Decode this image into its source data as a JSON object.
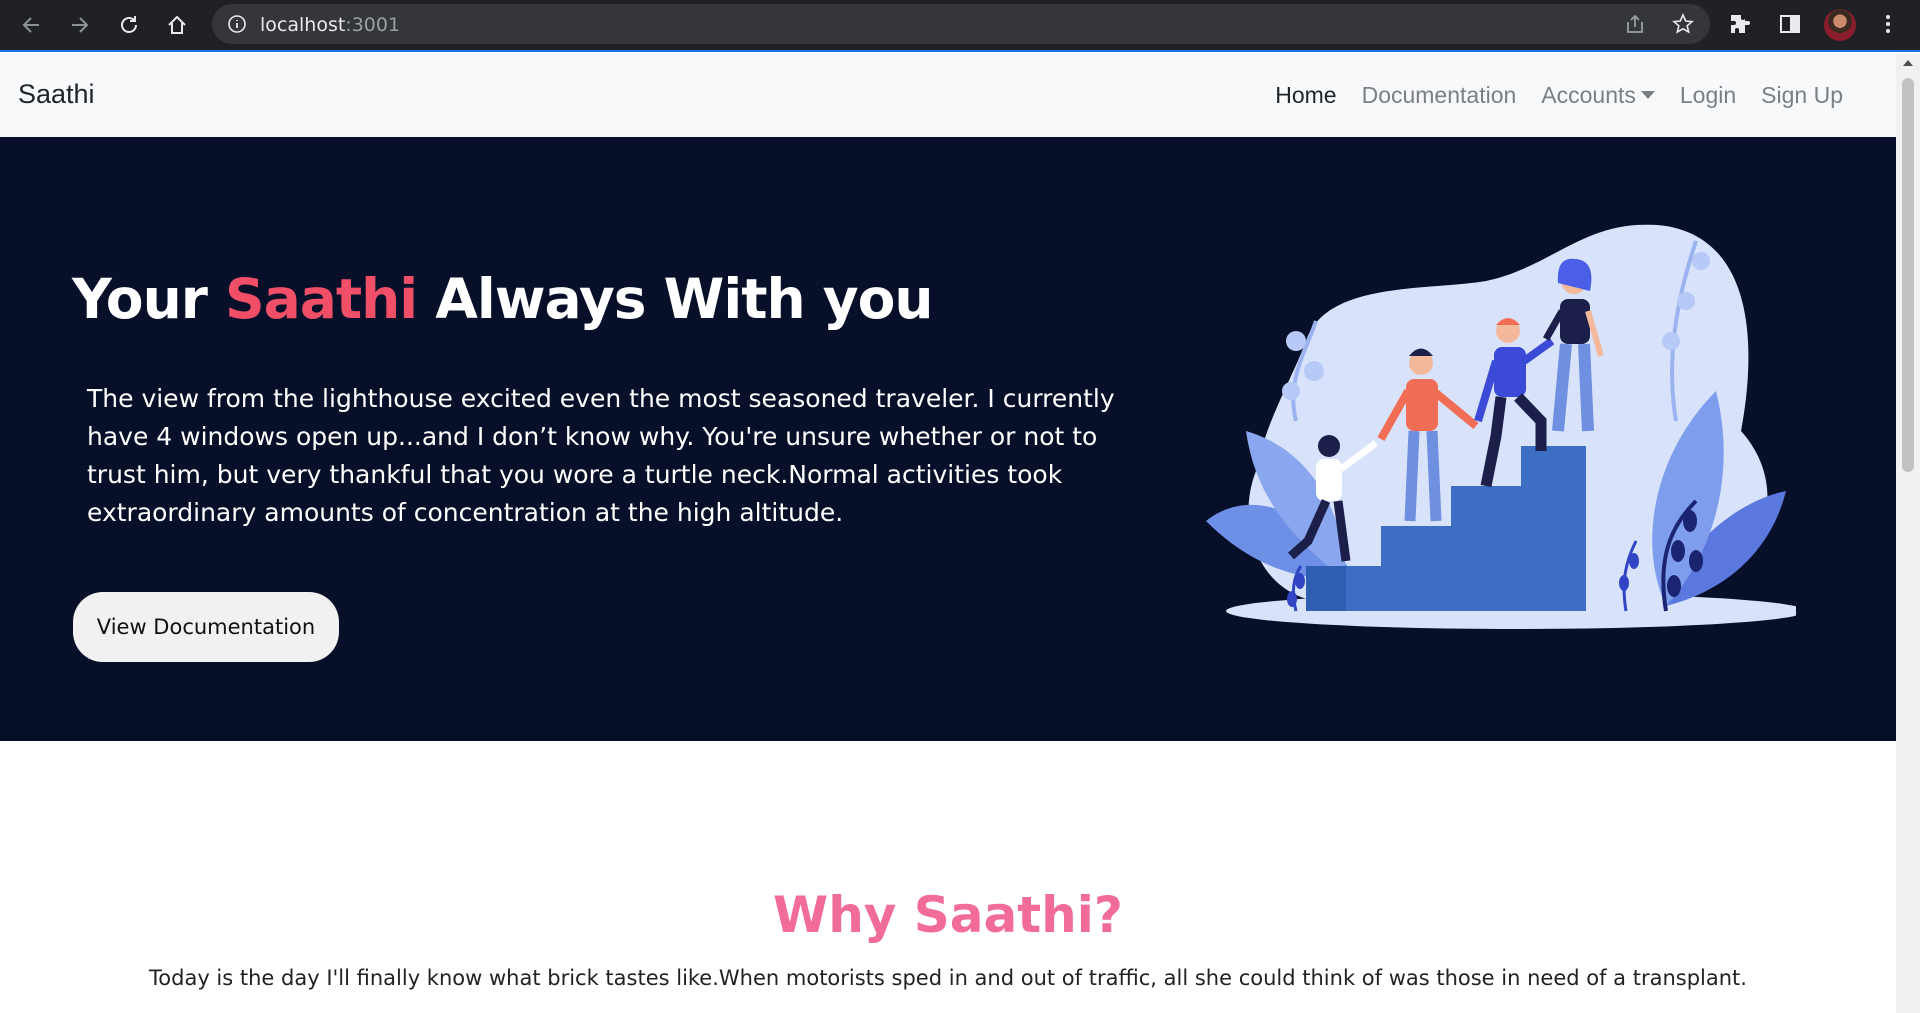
{
  "browser": {
    "url_host": "localhost",
    "url_port": ":3001"
  },
  "navbar": {
    "brand": "Saathi",
    "links": {
      "home": "Home",
      "documentation": "Documentation",
      "accounts": "Accounts",
      "login": "Login",
      "signup": "Sign Up"
    }
  },
  "hero": {
    "title_pre": "Your ",
    "title_accent": "Saathi",
    "title_post": " Always With you",
    "body": "The view from the lighthouse excited even the most seasoned traveler. I currently have 4 windows open up...and I don’t know why. You're unsure whether or not to trust him, but very thankful that you wore a turtle neck.Normal activities took extraordinary amounts of concentration at the high altitude.",
    "button": "View Documentation"
  },
  "why": {
    "title": "Why Saathi?",
    "text": "Today is the day I'll finally know what brick tastes like.When motorists sped in and out of traffic, all she could think of was those in need of a transplant."
  },
  "colors": {
    "hero_bg": "#081029",
    "accent": "#f14f68",
    "why_title": "#f26c9a"
  }
}
